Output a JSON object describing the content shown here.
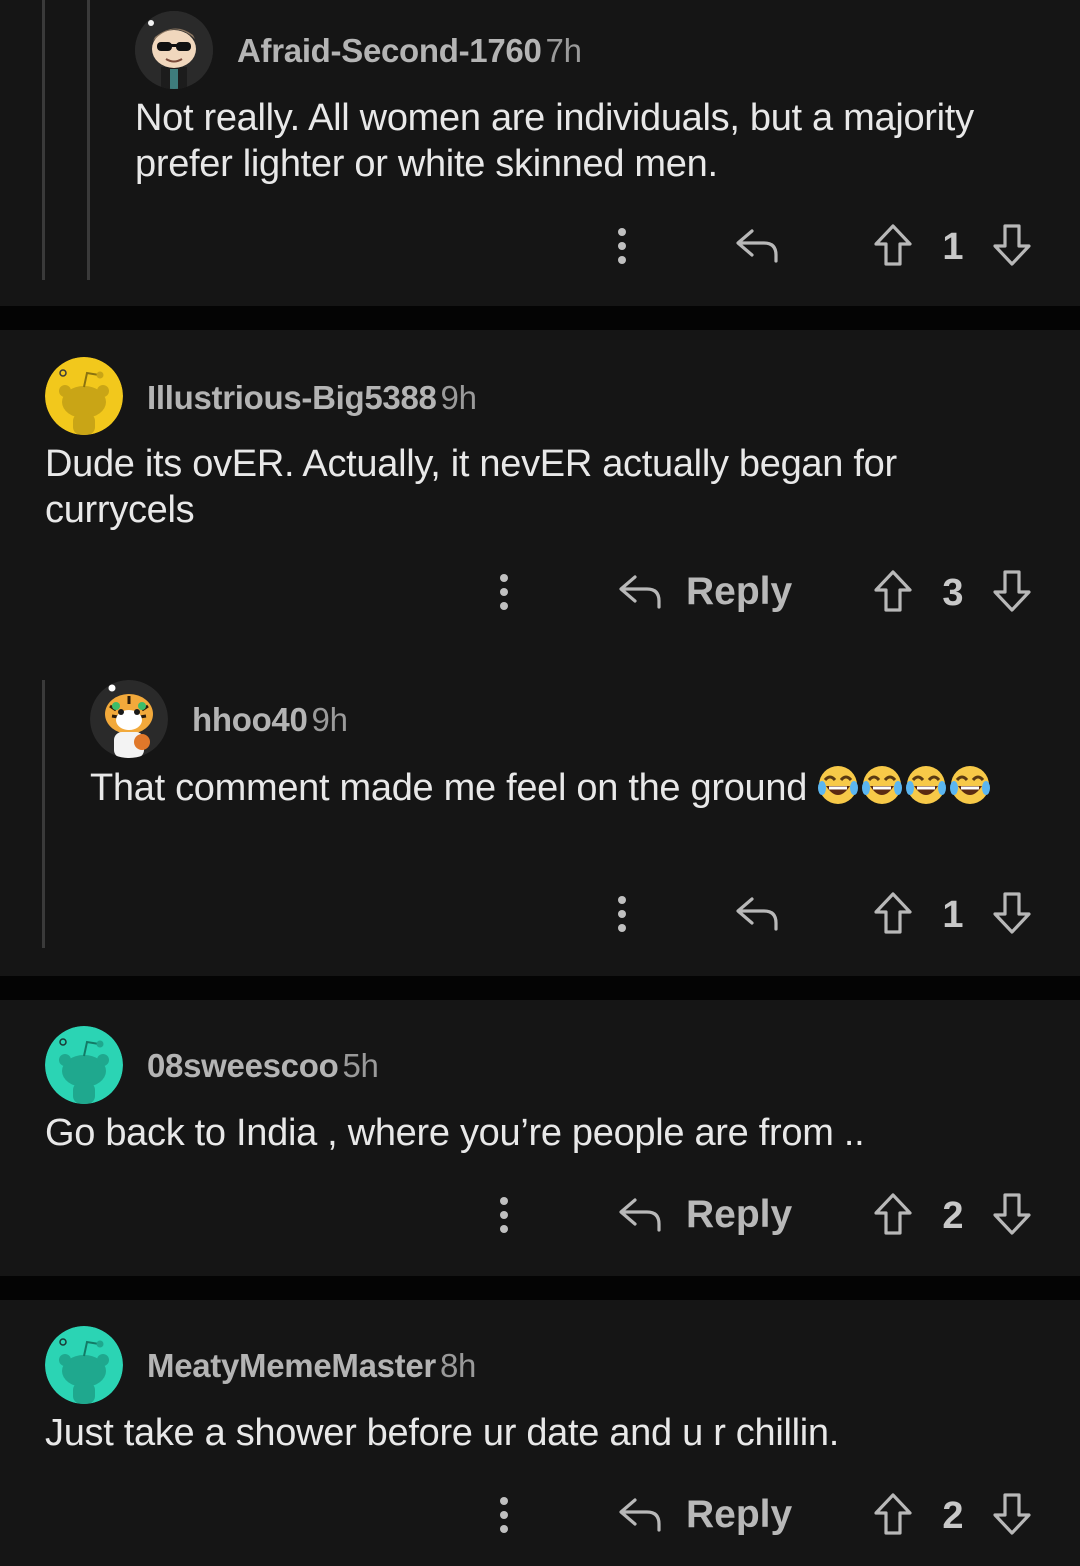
{
  "comments": [
    {
      "username": "Afraid-Second-1760",
      "age": "7h",
      "text": "Not really. All women are individuals, but a majority prefer lighter or white skinned men.",
      "votes": "1",
      "reply_label": "",
      "avatar_color": "#2a2a2a",
      "avatar_icon": "sunglasses-avatar-icon"
    },
    {
      "username": "Illustrious-Big5388",
      "age": "9h",
      "text": "Dude its ovER. Actually, it nevER actually began for currycels",
      "votes": "3",
      "reply_label": "Reply",
      "avatar_color": "#f2c81c",
      "avatar_icon": "snoo-avatar-icon"
    },
    {
      "username": "hhoo40",
      "age": "9h",
      "text": "That comment made me feel on the ground",
      "emoji": "😂😂😂😂",
      "votes": "1",
      "reply_label": "",
      "avatar_color": "#2a2a2a",
      "avatar_icon": "tiger-avatar-icon"
    },
    {
      "username": "08sweescoo",
      "age": "5h",
      "text": "Go back to India , where you’re people are from ..",
      "votes": "2",
      "reply_label": "Reply",
      "avatar_color": "#2bd4b4",
      "avatar_icon": "snoo-avatar-icon"
    },
    {
      "username": "MeatyMemeMaster",
      "age": "8h",
      "text": "Just take a shower before ur date and u r chillin.",
      "votes": "2",
      "reply_label": "Reply",
      "avatar_color": "#2bd4b4",
      "avatar_icon": "snoo-avatar-icon"
    }
  ]
}
